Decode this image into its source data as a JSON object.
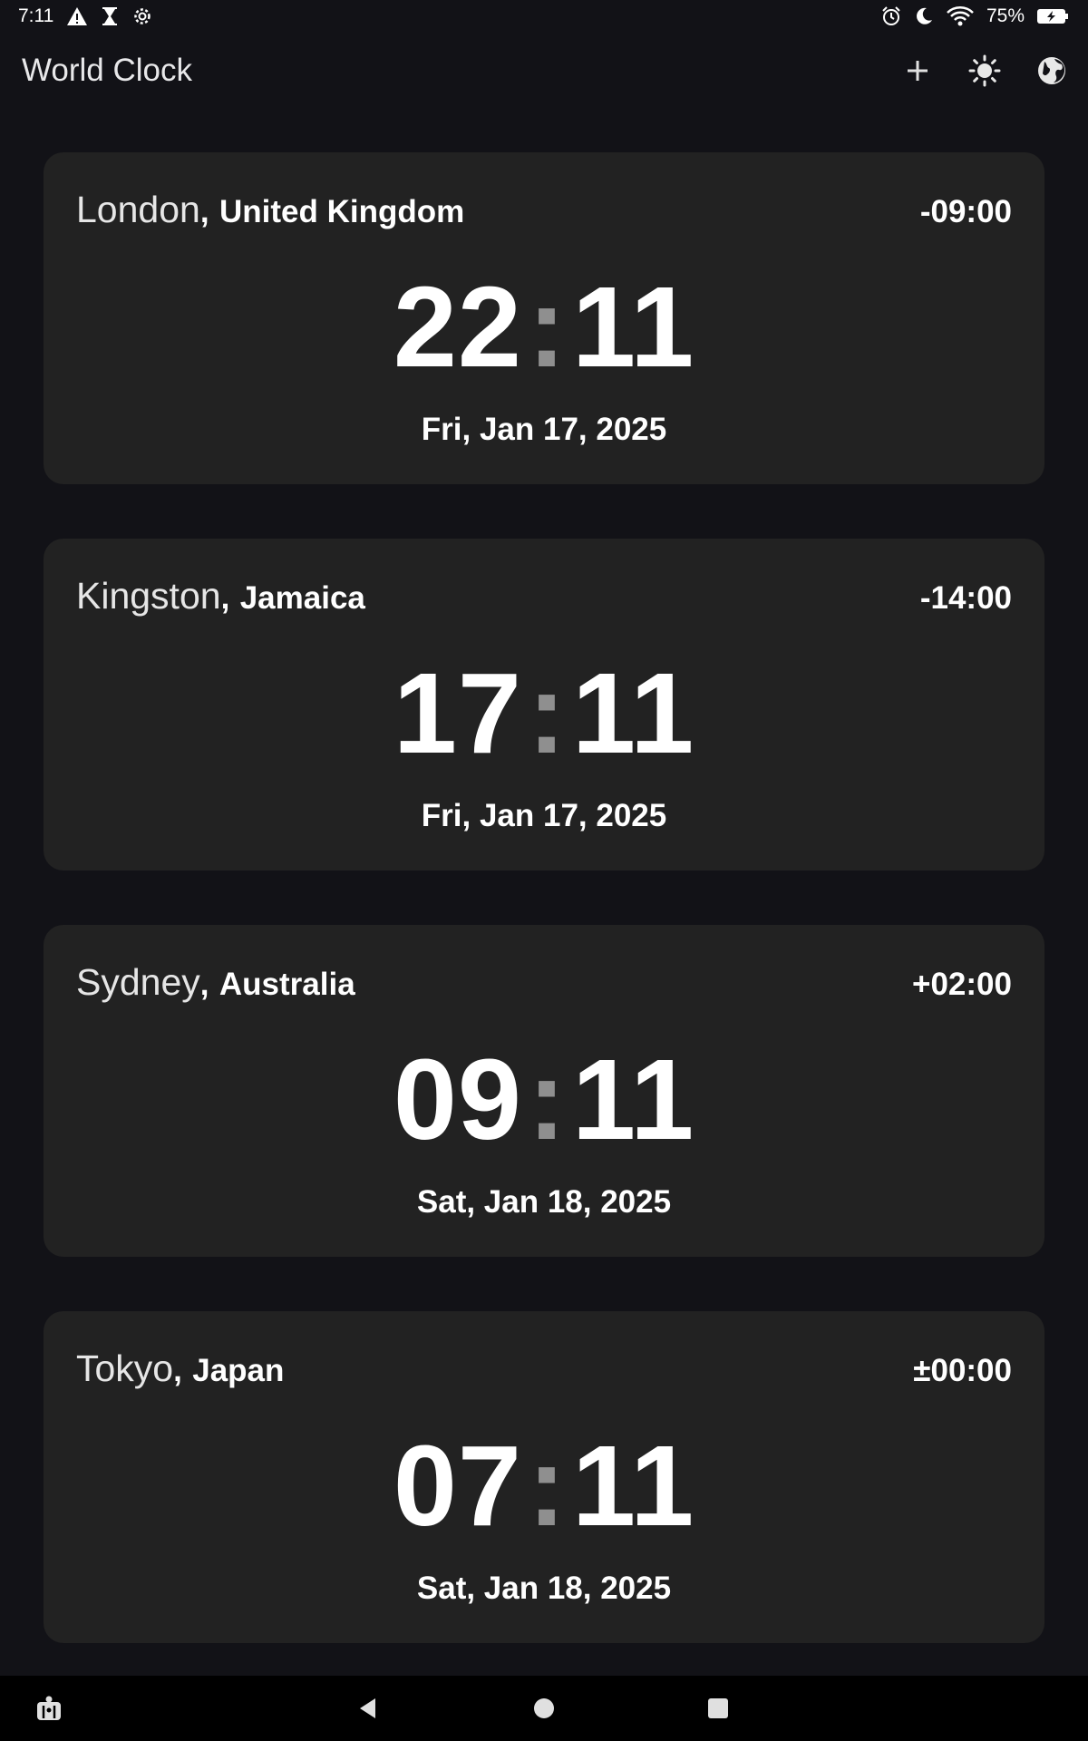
{
  "status_bar": {
    "time": "7:11",
    "battery_percent": "75%",
    "left_icons": [
      "warning-icon",
      "hourglass-icon",
      "settings-gear-icon"
    ],
    "right_icons": [
      "alarm-icon",
      "moon-icon",
      "wifi-icon",
      "battery-charging-icon"
    ]
  },
  "app_bar": {
    "title": "World Clock",
    "actions": [
      "add-icon",
      "brightness-icon",
      "globe-icon"
    ]
  },
  "clocks": [
    {
      "city": "London",
      "country": "United Kingdom",
      "offset": "-09:00",
      "hours": "22",
      "minutes": "11",
      "date": "Fri, Jan 17, 2025"
    },
    {
      "city": "Kingston",
      "country": "Jamaica",
      "offset": "-14:00",
      "hours": "17",
      "minutes": "11",
      "date": "Fri, Jan 17, 2025"
    },
    {
      "city": "Sydney",
      "country": "Australia",
      "offset": "+02:00",
      "hours": "09",
      "minutes": "11",
      "date": "Sat, Jan 18, 2025"
    },
    {
      "city": "Tokyo",
      "country": "Japan",
      "offset": "±00:00",
      "hours": "07",
      "minutes": "11",
      "date": "Sat, Jan 18, 2025"
    }
  ],
  "separator": ":",
  "comma": ",",
  "nav_bar": {
    "buttons": [
      "accessibility-icon",
      "back-icon",
      "home-icon",
      "recents-icon"
    ]
  },
  "colors": {
    "background": "#121217",
    "card": "#222222",
    "colon": "#8f8f8f"
  }
}
